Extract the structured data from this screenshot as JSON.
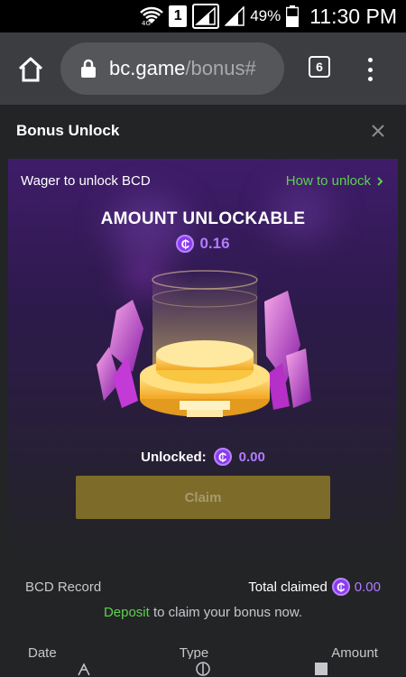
{
  "status_bar": {
    "battery_percent": "49%",
    "sim_label": "1",
    "time": "11:30 PM"
  },
  "browser": {
    "url_host": "bc.game",
    "url_path": "/bonus#",
    "tab_count": "6"
  },
  "modal": {
    "title": "Bonus Unlock"
  },
  "hero": {
    "subtitle": "Wager to unlock BCD",
    "how_link": "How to unlock",
    "title": "AMOUNT UNLOCKABLE",
    "amount": "0.16",
    "unlocked_label": "Unlocked:",
    "unlocked_value": "0.00",
    "claim_label": "Claim"
  },
  "record": {
    "label": "BCD Record",
    "total_label": "Total claimed",
    "total_value": "0.00",
    "deposit_link": "Deposit",
    "deposit_text": " to claim your bonus now."
  },
  "table": {
    "columns": [
      "Date",
      "Type",
      "Amount"
    ]
  },
  "colors": {
    "accent_green": "#5dd14d",
    "accent_purple": "#b27bff",
    "claim_button": "#7d6b2a"
  }
}
